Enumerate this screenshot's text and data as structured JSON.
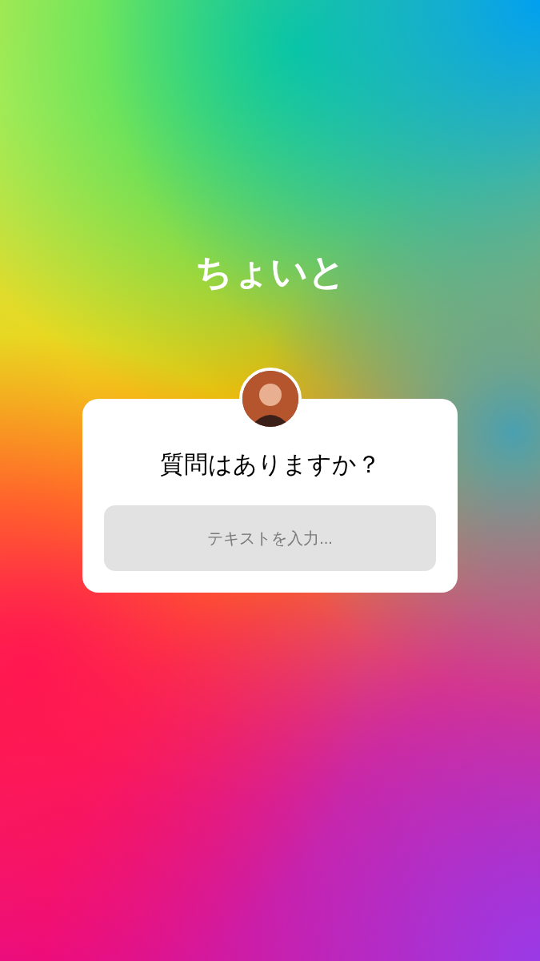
{
  "title": "ちょいと",
  "question_sticker": {
    "question": "質問はありますか？",
    "answer_field": {
      "placeholder": "テキストを入力..."
    }
  }
}
